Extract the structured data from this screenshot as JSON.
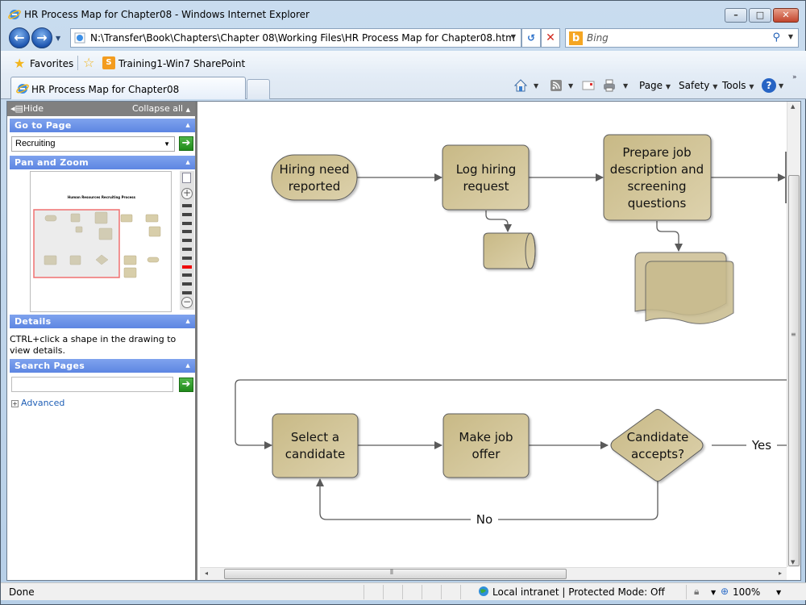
{
  "window": {
    "title": "HR Process Map for Chapter08 - Windows Internet Explorer",
    "min_label": "–",
    "max_label": "□",
    "close_label": "✕"
  },
  "nav": {
    "back_glyph": "←",
    "forward_glyph": "→",
    "address": "N:\\Transfer\\Book\\Chapters\\Chapter 08\\Working Files\\HR Process Map for Chapter08.htm",
    "refresh_glyph": "↺",
    "stop_glyph": "✕",
    "search_placeholder": "Bing",
    "search_glyph": "⚲"
  },
  "favorites": {
    "label": "Favorites",
    "links": [
      "Training1-Win7 SharePoint"
    ]
  },
  "tabs": [
    {
      "label": "HR Process Map for Chapter08",
      "active": true
    }
  ],
  "command_bar": {
    "page": "Page",
    "safety": "Safety",
    "tools": "Tools",
    "help": "?"
  },
  "sidebar": {
    "hide_label": "Hide",
    "collapse_label": "Collapse all",
    "sections": {
      "goto": "Go to Page",
      "pan": "Pan and Zoom",
      "details": "Details",
      "search": "Search Pages"
    },
    "goto_value": "Recruiting",
    "details_text": "CTRL+click a shape in the drawing to view details.",
    "search_value": "",
    "advanced_label": "Advanced",
    "thumbnail_title": "Human Resources Recruiting Process",
    "zoom_levels": 11,
    "zoom_selected_index": 7
  },
  "diagram": {
    "colors": {
      "shape_fill": "#d3c69d",
      "shape_stroke": "#5b5b5b",
      "connector": "#5a5a5a"
    },
    "shapes": {
      "hiring_need": [
        "Hiring need",
        "reported"
      ],
      "log_request": [
        "Log hiring",
        "request"
      ],
      "prepare_job": [
        "Prepare job",
        "description and",
        "screening",
        "questions"
      ],
      "select_candidate": [
        "Select a",
        "candidate"
      ],
      "make_offer": [
        "Make job",
        "offer"
      ],
      "candidate_accepts": [
        "Candidate",
        "accepts?"
      ]
    },
    "labels": {
      "yes": "Yes",
      "no": "No"
    }
  },
  "status": {
    "text": "Done",
    "zone": "Local intranet | Protected Mode: Off",
    "zoom": "100%"
  }
}
